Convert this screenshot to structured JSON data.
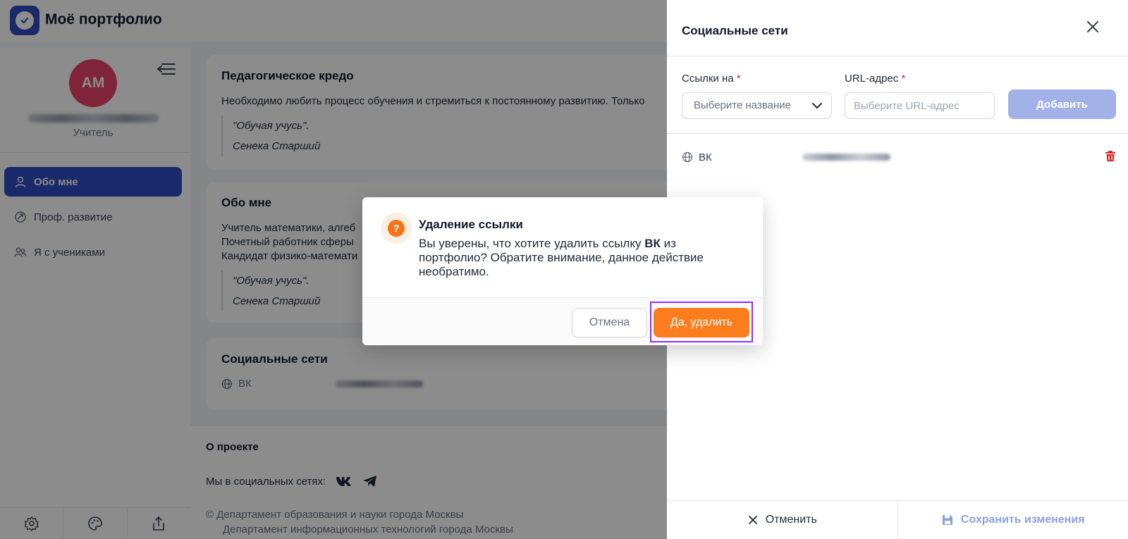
{
  "app": {
    "title": "Моё портфолио"
  },
  "profile": {
    "initials": "АМ",
    "role": "Учитель"
  },
  "sidebar": {
    "items": [
      {
        "label": "Обо мне",
        "icon": "user-icon",
        "active": true
      },
      {
        "label": "Проф. развитие",
        "icon": "growth-icon",
        "active": false
      },
      {
        "label": "Я с учениками",
        "icon": "users-icon",
        "active": false
      }
    ]
  },
  "cards": {
    "credo": {
      "title": "Педагогическое кредо",
      "text": "Необходимо любить процесс обучения и стремиться к постоянному развитию. Только",
      "quote_line1": "\"Обучая учусь\".",
      "quote_line2": "Сенека Старший"
    },
    "about": {
      "title": "Обо мне",
      "line1": "Учитель математики, алгеб",
      "line2": "Почетный работник сферы",
      "line3": "Кандидат физико-математи",
      "quote_line1": "\"Обучая учусь\".",
      "quote_line2": "Сенека Старший"
    },
    "socials": {
      "title": "Социальные сети",
      "item": "ВК"
    }
  },
  "footer": {
    "about": "О проекте",
    "socials_label": "Мы в социальных сетях:",
    "copyright1": "Департамент образования и науки города Москвы",
    "copyright2": "Департамент информационных технологий города Москвы"
  },
  "drawer": {
    "title": "Социальные сети",
    "links_label": "Ссылки на",
    "url_label": "URL-адрес",
    "required_mark": "*",
    "select_placeholder": "Выберите название",
    "url_placeholder": "Выберите URL-адрес",
    "add_label": "Добавить",
    "row_label": "ВК",
    "cancel_label": "Отменить",
    "save_label": "Сохранить изменения"
  },
  "dialog": {
    "title": "Удаление ссылки",
    "text_before": "Вы уверены, что хотите удалить ссылку ",
    "text_bold": "ВК",
    "text_after": " из портфолио? Обратите внимание, данное действие необратимо.",
    "cancel_label": "Отмена",
    "confirm_label": "Да, удалить"
  },
  "colors": {
    "accent": "#2f4bbf",
    "confirm": "#fb7d1e",
    "highlight": "#9333ea",
    "avatar": "#e8426b"
  }
}
